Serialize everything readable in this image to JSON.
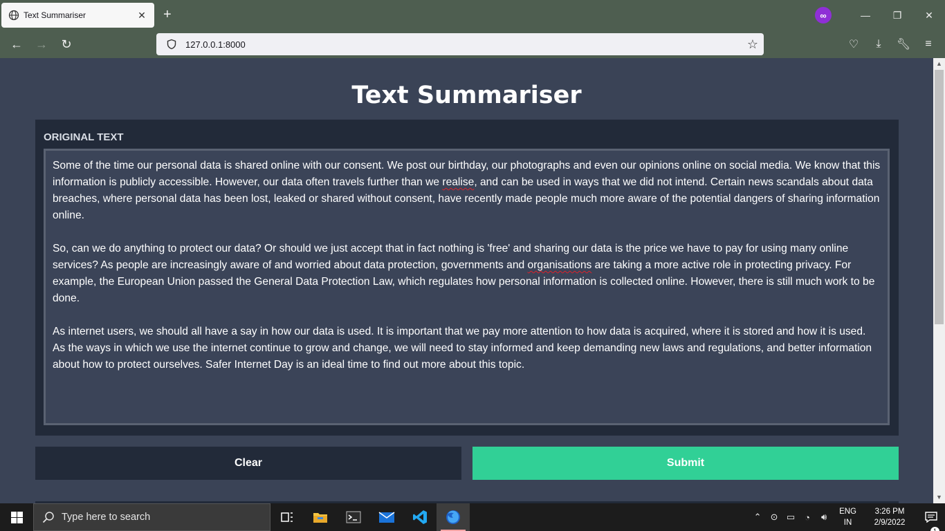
{
  "browser": {
    "tab_title": "Text Summariser",
    "tab_close": "✕",
    "new_tab": "+",
    "url": "127.0.0.1:8000"
  },
  "page": {
    "title": "Text Summariser",
    "section_label": "ORIGINAL TEXT",
    "paragraphs": [
      {
        "before": "Some of the time our personal data is shared online with our consent. We post our birthday, our photographs and even our opinions online on social media. We know that this information is publicly accessible. However, our data often travels further than we ",
        "misspelled": "realise",
        "after": ", and can be used in ways that we did not intend. Certain news scandals about data breaches, where personal data has been lost, leaked or shared without consent, have recently made people much more aware of the potential dangers of sharing information online."
      },
      {
        "before": "So, can we do anything to protect our data? Or should we just accept that in fact nothing is 'free' and sharing our data is the price we have to pay for using many online services? As people are increasingly aware of and worried about data protection, governments and ",
        "misspelled": "organisations",
        "after": " are taking a more active role in protecting privacy. For example, the European Union passed the General Data Protection Law, which regulates how personal information is collected online. However, there is still much work to be done."
      },
      {
        "text": "As internet users, we should all have a say in how our data is used. It is important that we pay more attention to how data is acquired, where it is stored and how it is used. As the ways in which we use the internet continue to grow and change, we will need to stay informed and keep demanding new laws and regulations, and better information about how to protect ourselves. Safer Internet Day is an ideal time to find out more about this topic."
      }
    ],
    "clear_label": "Clear",
    "submit_label": "Submit"
  },
  "taskbar": {
    "search_placeholder": "Type here to search",
    "lang_line1": "ENG",
    "lang_line2": "IN",
    "time": "3:26 PM",
    "date": "2/9/2022",
    "notification_count": "1"
  },
  "colors": {
    "page_bg": "#3a4356",
    "card_bg": "#222a39",
    "submit_bg": "#31d096",
    "chrome_bg": "#4e5e50"
  },
  "icons": [
    "globe-icon",
    "back-icon",
    "forward-icon",
    "reload-icon",
    "shield-icon",
    "page-icon",
    "star-icon",
    "pocket-icon",
    "download-icon",
    "wrench-icon",
    "menu-icon",
    "windows-logo-icon",
    "search-icon",
    "task-view-icon",
    "file-explorer-icon",
    "terminal-icon",
    "mail-icon",
    "vscode-icon",
    "firefox-icon"
  ]
}
